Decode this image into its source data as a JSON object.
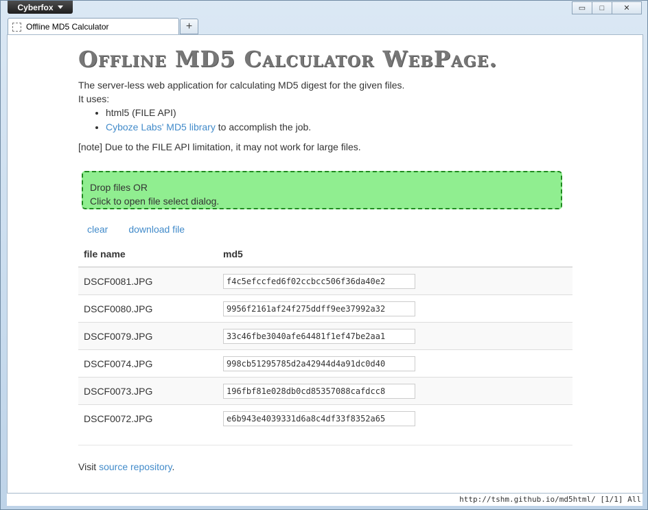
{
  "window": {
    "app_button": "Cyberfox",
    "controls": {
      "minimize": "▭",
      "maximize": "□",
      "close": "✕"
    }
  },
  "tab": {
    "title": "Offline MD5 Calculator",
    "new_tab": "+"
  },
  "page": {
    "title": "Offline MD5 Calculator WebPage.",
    "intro": "The server-less web application for calculating MD5 digest for the given files.",
    "uses_label": "It uses:",
    "uses_items": {
      "item1": "html5 (FILE API)",
      "item2_link": "Cyboze Labs' MD5 library",
      "item2_suffix": " to accomplish the job."
    },
    "note": "[note] Due to the FILE API limitation, it may not work for large files.",
    "dropzone": {
      "line1": "Drop files OR",
      "line2": "Click to open file select dialog."
    },
    "actions": {
      "clear": "clear",
      "download": "download file"
    },
    "table": {
      "headers": [
        "file name",
        "md5"
      ],
      "rows": [
        {
          "file": "DSCF0081.JPG",
          "md5": "f4c5efccfed6f02ccbcc506f36da40e2"
        },
        {
          "file": "DSCF0080.JPG",
          "md5": "9956f2161af24f275ddff9ee37992a32"
        },
        {
          "file": "DSCF0079.JPG",
          "md5": "33c46fbe3040afe64481f1ef47be2aa1"
        },
        {
          "file": "DSCF0074.JPG",
          "md5": "998cb51295785d2a42944d4a91dc0d40"
        },
        {
          "file": "DSCF0073.JPG",
          "md5": "196fbf81e028db0cd85357088cafdcc8"
        },
        {
          "file": "DSCF0072.JPG",
          "md5": "e6b943e4039331d6a8c4df33f8352a65"
        }
      ]
    },
    "footer": {
      "prefix": "Visit ",
      "link": "source repository",
      "suffix": "."
    }
  },
  "statusbar": {
    "text": "http://tshm.github.io/md5html/ [1/1] All"
  }
}
